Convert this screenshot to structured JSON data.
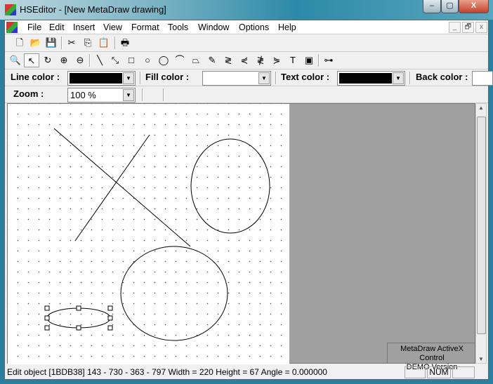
{
  "window": {
    "title": "HSEditor - [New MetaDraw drawing]",
    "minimize": "–",
    "maximize": "▢",
    "close": "X"
  },
  "menu": [
    "File",
    "Edit",
    "Insert",
    "View",
    "Format",
    "Tools",
    "Window",
    "Options",
    "Help"
  ],
  "mdi_controls": [
    "_",
    "🗗",
    "x"
  ],
  "toolbar_file": [
    {
      "name": "new",
      "g": "🗋"
    },
    {
      "name": "open",
      "g": "📂"
    },
    {
      "name": "save",
      "g": "💾"
    },
    {
      "name": "cut",
      "g": "✂"
    },
    {
      "name": "copy",
      "g": "⎘"
    },
    {
      "name": "paste",
      "g": "📋"
    },
    {
      "name": "print",
      "g": "🖶"
    }
  ],
  "toolbar_draw": [
    {
      "name": "zoom-tool",
      "g": "🔍"
    },
    {
      "name": "select",
      "g": "↖"
    },
    {
      "name": "rotate",
      "g": "↻"
    },
    {
      "name": "zoom-in",
      "g": "⊕"
    },
    {
      "name": "zoom-out",
      "g": "⊖"
    },
    {
      "name": "line",
      "g": "╲"
    },
    {
      "name": "arrow-line",
      "g": "⤡"
    },
    {
      "name": "rectangle",
      "g": "□"
    },
    {
      "name": "circle",
      "g": "○"
    },
    {
      "name": "ellipse",
      "g": "◯"
    },
    {
      "name": "arc",
      "g": "⌒"
    },
    {
      "name": "polygon",
      "g": "⏢"
    },
    {
      "name": "freehand",
      "g": "✎"
    },
    {
      "name": "polyline",
      "g": "≷"
    },
    {
      "name": "curve",
      "g": "⋞"
    },
    {
      "name": "bezier",
      "g": "≹"
    },
    {
      "name": "spline",
      "g": "⋟"
    },
    {
      "name": "text",
      "g": "T"
    },
    {
      "name": "image",
      "g": "▣"
    },
    {
      "name": "connector",
      "g": "⊶"
    }
  ],
  "format": {
    "line_color_label": "Line color :",
    "line_color": "#000000",
    "fill_color_label": "Fill color :",
    "fill_color": "#ffffff",
    "text_color_label": "Text color :",
    "text_color": "#000000",
    "back_color_label": "Back color :",
    "zoom_label": "Zoom :",
    "zoom_value": "100 %"
  },
  "canvas": {
    "watermark_line1": "MetaDraw ActiveX Control",
    "watermark_line2": "DEMO Version"
  },
  "status": {
    "text": "Edit object [1BDB38] 143 - 730 - 363 - 797  Width = 220  Height = 67 Angle = 0.000000",
    "num": "NUM"
  }
}
